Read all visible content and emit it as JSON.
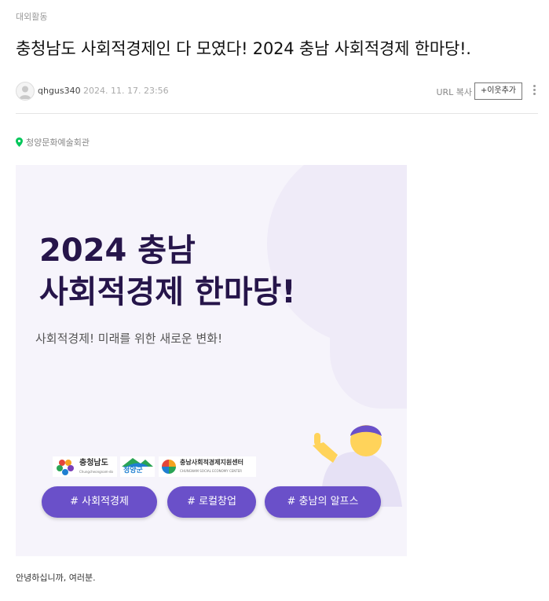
{
  "post": {
    "category": "대외활동",
    "title": "충청남도 사회적경제인 다 모였다! 2024 충남 사회적경제 한마당!.",
    "author": "qhgus340",
    "date": "2024. 11. 17. 23:56",
    "url_copy": "URL 복사",
    "add_neighbor": "+이웃추가",
    "location": "청양문화예술회관",
    "greeting": "안녕하십니까, 여러분."
  },
  "banner": {
    "headline_line1": "2024 충남",
    "headline_line2": "사회적경제 한마당!",
    "subheadline": "사회적경제! 미래를 위한 새로운 변화!",
    "logos": {
      "chungnam": "충청남도",
      "chungnam_en": "Chungcheongnam-do",
      "cheongyang": "청양군",
      "center": "충남사회적경제지원센터",
      "center_en": "CHUNGNAM SOCIAL ECONOMY CENTER"
    },
    "tags": [
      "# 사회적경제",
      "# 로컬창업",
      "# 충남의 알프스"
    ]
  },
  "colors": {
    "accent": "#6a50c9",
    "headline": "#26154a",
    "banner_bg": "#f6f4fb"
  }
}
